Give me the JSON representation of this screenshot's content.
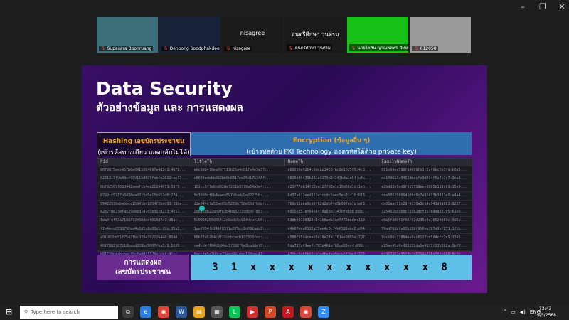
{
  "window": {
    "min": "–",
    "max": "❐",
    "close": "✕"
  },
  "participants": [
    {
      "name": "Supasara Boonruang",
      "w": 86,
      "bg": "#3c6f7a"
    },
    {
      "name": "Denpong Soodphakdee",
      "w": 86,
      "bg": "#16223a"
    },
    {
      "name": "nisagree",
      "w": 86,
      "bg": "#1a1a1a",
      "center": "nisagree"
    },
    {
      "name": "ดนตรีศึกษา วนศรม",
      "w": 86,
      "bg": "#1a1a1a",
      "center": "ดนตรีศึกษา วนศรม"
    },
    {
      "name": "นายไพศน ญาณพลพร_วิทยา...",
      "w": 86,
      "bg": "#16c016"
    },
    {
      "name": "612050",
      "w": 86,
      "bg": "#9a9a9a"
    }
  ],
  "slide": {
    "title": "Data Security",
    "subtitle": "ตัวอย่างข้อมูล และ การแสดงผล",
    "hashing": {
      "title": "Hashing เลขบัตรประชาชน",
      "sub": "(เข้ารหัสทางเดียว ถอดกลับไม่ได้)"
    },
    "encryption": {
      "title": "Encryption (ข้อมูลอื่น ๆ)",
      "sub": "(เข้ารหัสด้วย PKI Technology ถอดรหัสได้ด้วย private key)"
    },
    "table": {
      "headers": [
        "Pid",
        "TitleTh",
        "NameTh",
        "FamilyNameTh"
      ],
      "rows": [
        [
          "6079875eec457b6e0411084697e4d2d1:4b78...",
          "ebc9db4f0ea097113b25a4d617a4e3a37:...",
          "d89580e9264c0dcbd3455fbc8d102595:4c8...",
          "081c04ea590f84009fb1c2c49bc5b3fd:b0a5..."
        ],
        [
          "0231317f9b08cf709115d599febfe2611:ee17...",
          "c8684eddbb882bb0b8317ce35d17534Af:...",
          "0820d4043Sb281e3179d2f343b8a1e5f:a4e...",
          "dd1596S1a0462dbcefe3d994f6a7b7c7:2ea3..."
        ],
        [
          "0bf82507f08d442aeefcb4ea21104073:58f9...",
          "153cc9f7e6bd02de7261b9370a64a3e4:...",
          "d23f77ab14f82ea127fd3e1c10d66d1d:1eb...",
          "e2bdd2e5ad9f917158eee9665b119c69:15e9..."
        ],
        [
          "0799ic5717b3438ea0315d5e15b652d6:27d...",
          "0c3009cf0b4eaea597d6a4d9a922750:...",
          "8d37a012ead153cfccdc5aec5eb21f18:613...",
          "cea505258094100d9c7e95033b3811e9:e4a4..."
        ],
        [
          "59422930abebbcc15941bd1054f2bdd03:38ba...",
          "22e044cfa53ae03c5239b758e53df6da:...",
          "769c92aba9cd0f62d2dbf4d5b997ea7a:af3...",
          "da01aac51c29f4130a3cb4a543d9d883:8237..."
        ],
        [
          "e2e2fde27efac25eeed147d5b01cd233:4551...",
          "2d81edb22ab9fe3b4ba3233cd507708:...",
          "e055ed51ef0466f78a6de73430fdb56:bde...",
          "725482bdcbbc539b2dcf317edeadb705:61ee..."
        ],
        [
          "1da0f4f53a718d372450ddef818d7a7:d8ac...",
          "5c0958209d05f12d0adb5e934dcbf1b6:...",
          "83db93198328c543b0ada7ed4475bcdd:119...",
          "c5b5f480f1f66ff2d235e4c76524d69c:9d2b..."
        ],
        [
          "f1b4ece0533792ea4b6d1c8e05b1cfbb:35a2...",
          "1aef054fb241f03f1a575cc9d091ada9:...",
          "d4b67eea6112a15ae4c5cf4b0392ebe8:d54...",
          "79ad70dafa95b190f955eef87d3af271:1fdb..."
        ],
        [
          "a91d82bb51f7547fbcd78439222e448:834d...",
          "00b7fa5284c9f22cdbcacb137308fec:...",
          "c580f95daceab5e30e2fa1701ae9855e:797...",
          "9ccb98c77804ea0ac0127bc5f4cfc7e9:1342..."
        ],
        [
          "4617802f87218bead358bd9007fea3c9:2639...",
          "ca4cd4f784d9d4ac3f586f9e9baddef8:...",
          "5da73fd41eefc781d401efb0cd09cc4:899...",
          "a15ac41d0c431111de1e41f3f33b0b2a:5bf0..."
        ],
        [
          "b01728d4abcbac35cfa0011328efcbf:91cc...",
          "8accfe5d7d9ce73eea9a1dad188bec41:...",
          "43fcc5db5bb2ca2ad6efea5eca5f3ae1:723...",
          "b1967482a35f3b1d6704a398a7f6b886:8c2c..."
        ],
        [
          "ca0b26f93d2d30c7c39ab5972dbcb19c:d972...",
          "9ee54fa9b7fe6f8d1fe235756e1966cb:...",
          "559ba2c22f869d5eeda2adf39e4b6dd0:4ad...",
          "dad9ef2f170e263d5e822e6b6ef25661:2f37..."
        ]
      ]
    },
    "result_label": [
      "การแสดงผล",
      "เลขบัตรประชาชน"
    ],
    "result_value": "3 1 x x x x x x x x x x 8"
  },
  "taskbar": {
    "search_placeholder": "Type here to search",
    "lang": "ENG",
    "time": "13:43",
    "date": "19/5/2568",
    "apps": [
      {
        "name": "task-view-icon",
        "glyph": "⧉",
        "color": "#3a3a3a"
      },
      {
        "name": "edge-icon",
        "glyph": "e",
        "color": "#2a7de1"
      },
      {
        "name": "chrome-icon",
        "glyph": "◉",
        "color": "#db4437"
      },
      {
        "name": "word-icon",
        "glyph": "W",
        "color": "#2b579a"
      },
      {
        "name": "explorer-icon",
        "glyph": "▤",
        "color": "#e8a317"
      },
      {
        "name": "files-icon",
        "glyph": "▦",
        "color": "#555"
      },
      {
        "name": "line-icon",
        "glyph": "L",
        "color": "#06c755"
      },
      {
        "name": "app-red-icon",
        "glyph": "▶",
        "color": "#d32f2f"
      },
      {
        "name": "powerpoint-icon",
        "glyph": "P",
        "color": "#d24726"
      },
      {
        "name": "acrobat-icon",
        "glyph": "A",
        "color": "#c4161c"
      },
      {
        "name": "chrome2-icon",
        "glyph": "◉",
        "color": "#db4437"
      },
      {
        "name": "zoom-icon",
        "glyph": "Z",
        "color": "#2d8cff"
      }
    ]
  }
}
